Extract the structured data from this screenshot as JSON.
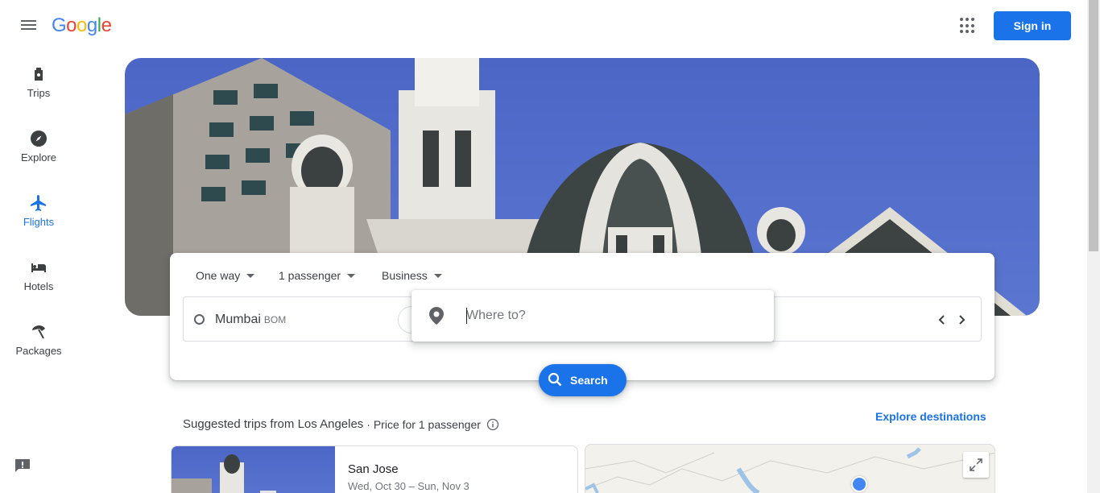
{
  "header": {
    "logo_letters": [
      "G",
      "o",
      "o",
      "g",
      "l",
      "e"
    ],
    "logo_colors": [
      "#4285f4",
      "#ea4335",
      "#fbbc05",
      "#4285f4",
      "#34a853",
      "#ea4335"
    ],
    "sign_in_label": "Sign in"
  },
  "sidebar": {
    "items": [
      {
        "label": "Trips",
        "icon": "luggage-icon"
      },
      {
        "label": "Explore",
        "icon": "compass-icon"
      },
      {
        "label": "Flights",
        "icon": "airplane-icon",
        "active": true
      },
      {
        "label": "Hotels",
        "icon": "bed-icon"
      },
      {
        "label": "Packages",
        "icon": "beach-umbrella-icon"
      }
    ],
    "accent_color": "#1a73e8"
  },
  "search": {
    "trip_type": "One way",
    "passengers": "1 passenger",
    "cabin_class": "Business",
    "origin_city": "Mumbai",
    "origin_code": "BOM",
    "destination_placeholder": "Where to?",
    "search_label": "Search"
  },
  "suggestions": {
    "title": "Suggested trips from Los Angeles",
    "subtitle": "· Price for 1 passenger",
    "explore_label": "Explore destinations",
    "trips": [
      {
        "city": "San Jose",
        "dates": "Wed, Oct 30 – Sun, Nov 3"
      }
    ]
  }
}
